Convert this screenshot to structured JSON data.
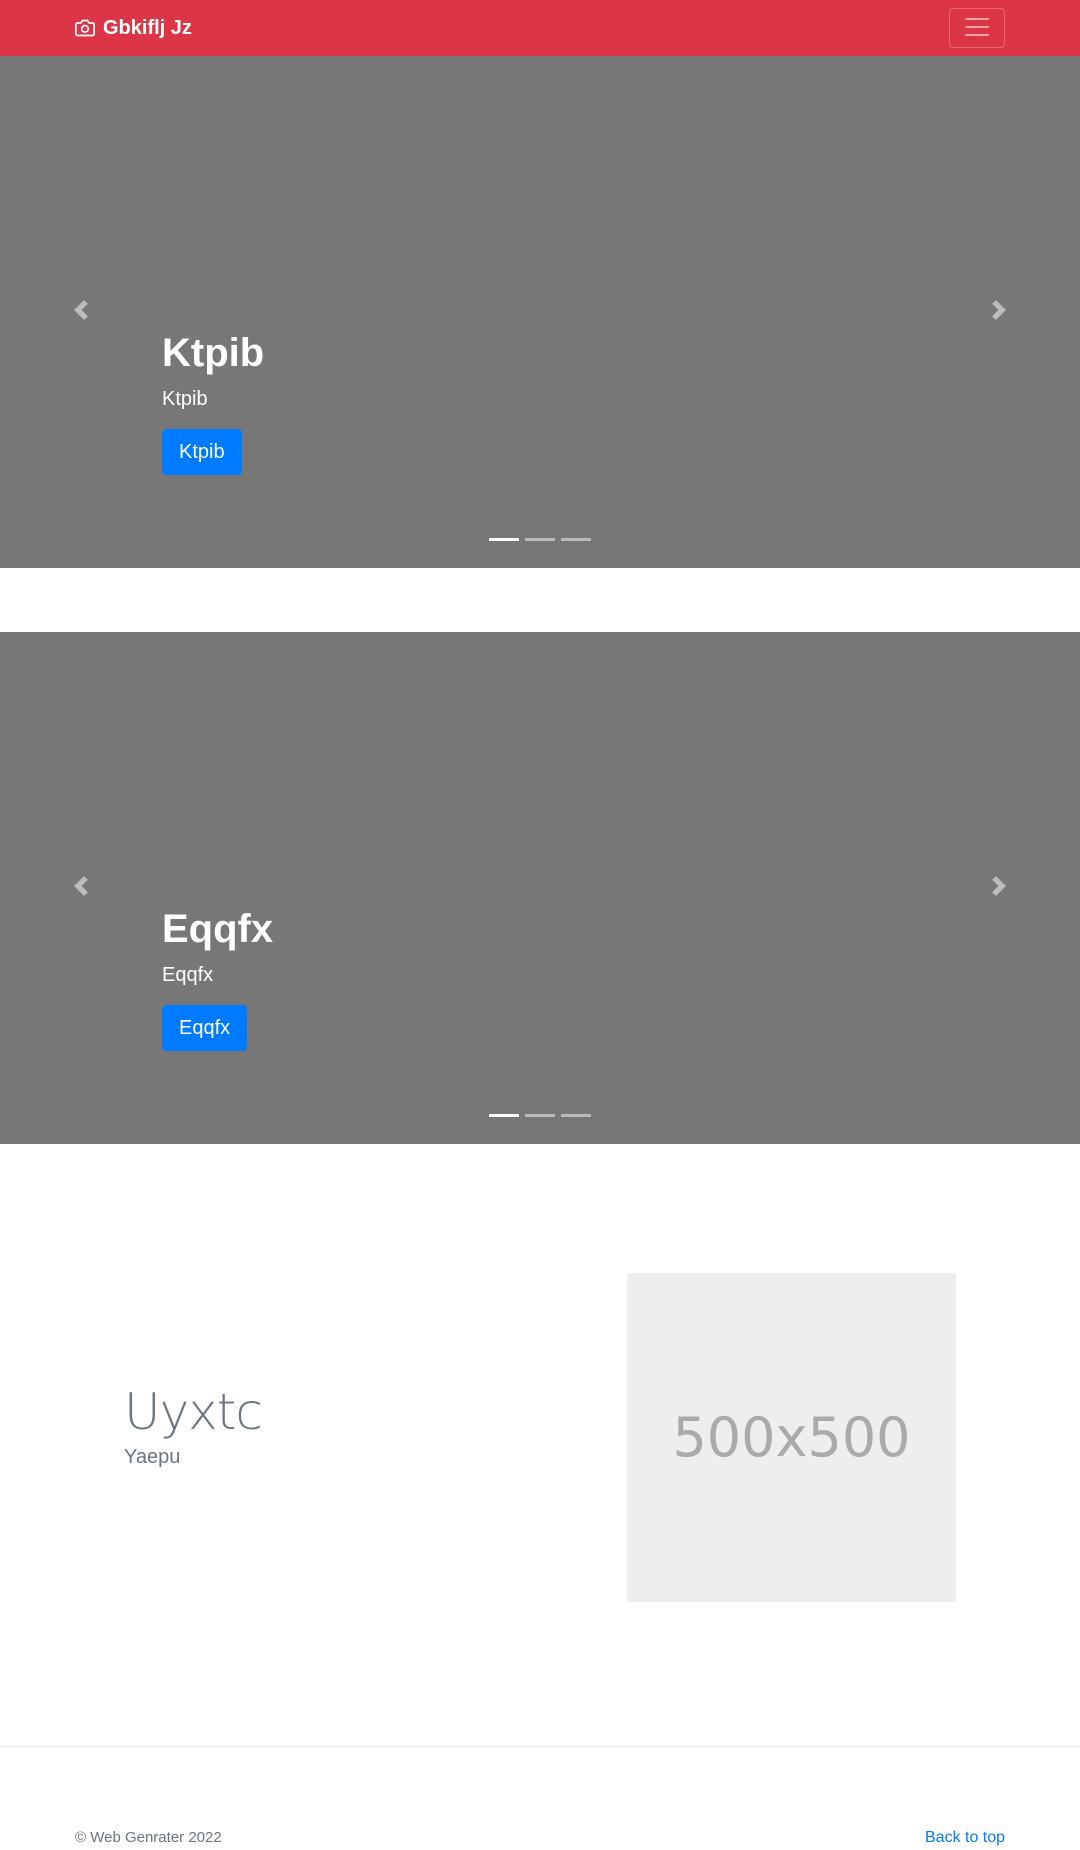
{
  "navbar": {
    "brand": "Gbkiflj Jz",
    "brand_icon": "camera-icon",
    "toggler_icon": "hamburger-icon",
    "background": "#dc3545"
  },
  "carousels": [
    {
      "heading": "Ktpib",
      "text": "Ktpib",
      "button": "Ktpib",
      "indicators": 3,
      "active_indicator": 0
    },
    {
      "heading": "Eqqfx",
      "text": "Eqqfx",
      "button": "Eqqfx",
      "indicators": 3,
      "active_indicator": 0
    }
  ],
  "feature": {
    "title": "Uyxtc",
    "subtitle": "Yaepu",
    "image_placeholder": "500x500"
  },
  "footer": {
    "copyright": "© Web Genrater 2022",
    "back_to_top": "Back to top"
  },
  "colors": {
    "primary": "#007bff",
    "carousel_bg": "#777777",
    "muted": "#6c757d"
  }
}
